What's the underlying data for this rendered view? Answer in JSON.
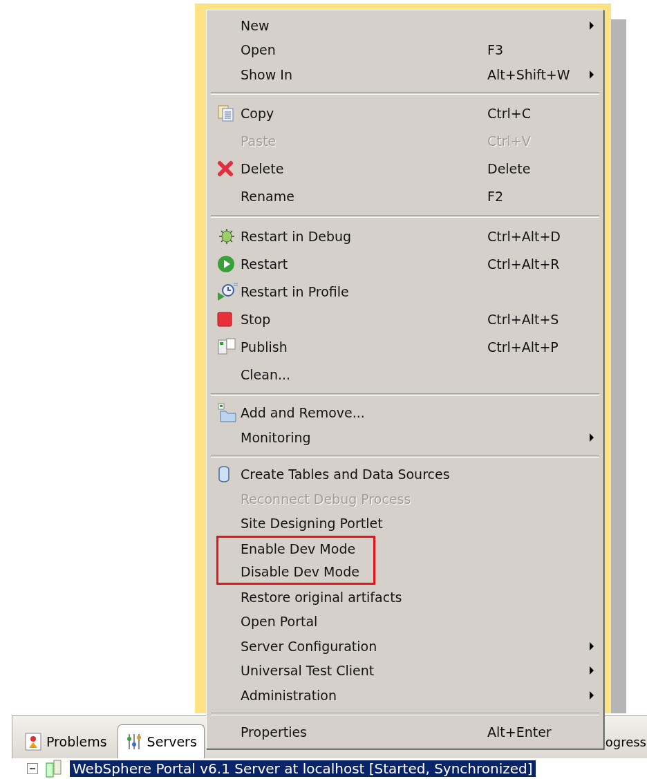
{
  "panel": {
    "tabs": [
      {
        "label": "Problems",
        "kind": "problems",
        "selected": false
      },
      {
        "label": "Servers",
        "kind": "servers",
        "selected": true
      },
      {
        "label": "ogress",
        "kind": "plain",
        "selected": false
      }
    ],
    "tree": [
      {
        "label": "WebSphere Portal v6.1 Server at localhost  [Started, Synchronized]",
        "expanded": true,
        "selected": true
      }
    ]
  },
  "context_menu": {
    "sections": [
      {
        "items": [
          {
            "label": "New",
            "submenu": true,
            "disabled": false
          },
          {
            "label": "Open",
            "shortcut": "F3",
            "disabled": false
          },
          {
            "label": "Show In",
            "shortcut": "Alt+Shift+W",
            "submenu": true,
            "disabled": false
          }
        ]
      },
      {
        "items": [
          {
            "label": "Copy",
            "shortcut": "Ctrl+C",
            "kind": "copy",
            "disabled": false
          },
          {
            "label": "Paste",
            "shortcut": "Ctrl+V",
            "disabled": true
          },
          {
            "label": "Delete",
            "shortcut": "Delete",
            "kind": "delete",
            "disabled": false
          },
          {
            "label": "Rename",
            "shortcut": "F2",
            "disabled": false
          }
        ]
      },
      {
        "items": [
          {
            "label": "Restart in Debug",
            "shortcut": "Ctrl+Alt+D",
            "kind": "debug",
            "disabled": false
          },
          {
            "label": "Restart",
            "shortcut": "Ctrl+Alt+R",
            "kind": "restart",
            "disabled": false
          },
          {
            "label": "Restart in Profile",
            "kind": "profile",
            "disabled": false
          },
          {
            "label": "Stop",
            "shortcut": "Ctrl+Alt+S",
            "kind": "stop",
            "disabled": false
          },
          {
            "label": "Publish",
            "shortcut": "Ctrl+Alt+P",
            "kind": "publish",
            "disabled": false
          },
          {
            "label": "Clean...",
            "disabled": false
          }
        ]
      },
      {
        "items": [
          {
            "label": "Add and Remove...",
            "kind": "folder",
            "disabled": false
          },
          {
            "label": "Monitoring",
            "submenu": true,
            "disabled": false
          }
        ]
      },
      {
        "items": [
          {
            "label": "Create Tables and Data Sources",
            "kind": "database",
            "disabled": false
          },
          {
            "label": "Reconnect Debug Process",
            "disabled": true
          },
          {
            "label": "Site Designing Portlet",
            "disabled": false
          },
          {
            "label": "Enable Dev Mode",
            "disabled": false,
            "highlighted": true
          },
          {
            "label": "Disable Dev Mode",
            "disabled": false,
            "highlighted": true
          },
          {
            "label": "Restore original artifacts",
            "disabled": false
          },
          {
            "label": "Open Portal",
            "disabled": false
          },
          {
            "label": "Server Configuration",
            "submenu": true,
            "disabled": false
          },
          {
            "label": "Universal Test Client",
            "submenu": true,
            "disabled": false
          },
          {
            "label": "Administration",
            "submenu": true,
            "disabled": false
          }
        ]
      },
      {
        "items": [
          {
            "label": "Properties",
            "shortcut": "Alt+Enter",
            "disabled": false
          }
        ]
      }
    ]
  }
}
